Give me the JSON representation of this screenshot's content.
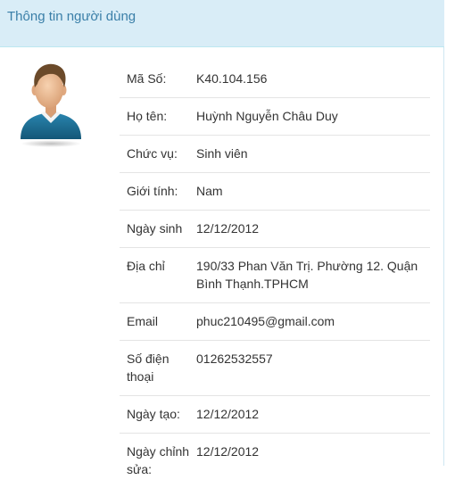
{
  "panel": {
    "title": "Thông tin người dùng"
  },
  "avatar": {
    "icon": "user-avatar-icon"
  },
  "fields": [
    {
      "label": "Mã Số:",
      "value": "K40.104.156"
    },
    {
      "label": "Họ tên:",
      "value": "Huỳnh Nguyễn Châu Duy"
    },
    {
      "label": "Chức vụ:",
      "value": "Sinh viên"
    },
    {
      "label": "Giới tính:",
      "value": "Nam"
    },
    {
      "label": "Ngày sinh",
      "value": "12/12/2012"
    },
    {
      "label": "Địa chỉ",
      "value": "190/33 Phan Văn Trị. Phường 12. Quận Bình Thạnh.TPHCM"
    },
    {
      "label": "Email",
      "value": "phuc210495@gmail.com"
    },
    {
      "label": "Số điện thoại",
      "value": "01262532557"
    },
    {
      "label": "Ngày tạo:",
      "value": "12/12/2012"
    },
    {
      "label": "Ngày chỉnh sửa:",
      "value": "12/12/2012"
    }
  ],
  "colors": {
    "header_bg": "#d9edf7",
    "header_text": "#3a7fa8",
    "shirt": "#1f6f95",
    "hair": "#6b4a2a"
  }
}
